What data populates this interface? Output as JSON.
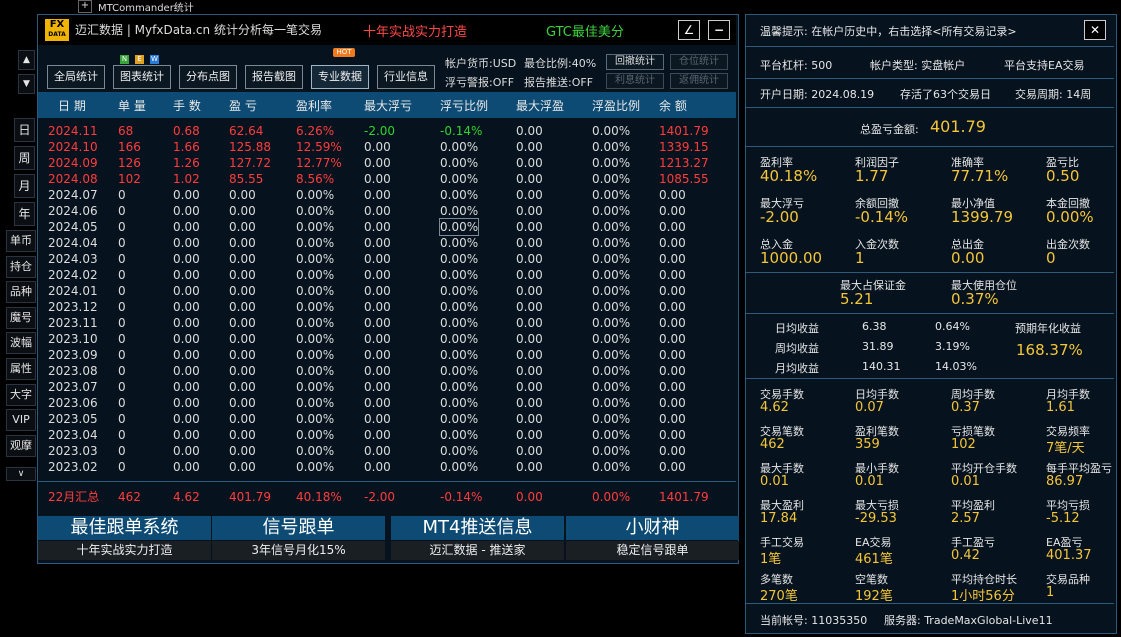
{
  "window": {
    "title": "MTCommander统计",
    "plus": "+"
  },
  "header": {
    "logo_top": "FX",
    "logo_bottom": "DATA",
    "brand": "迈汇数据 | MyfxData.cn  统计分析每一笔交易",
    "slogan1": "十年实战实力打造",
    "slogan2": "GTC最佳美分",
    "edit_btn": "∠",
    "min_btn": "−"
  },
  "sidebar": {
    "up": "▲",
    "down": "▼",
    "period": [
      "日",
      "周",
      "月",
      "年"
    ],
    "items": [
      "单币",
      "持仓",
      "品种",
      "魔号",
      "波幅",
      "属性",
      "大字",
      "VIP",
      "观摩"
    ],
    "more": "∨"
  },
  "toolbar": {
    "buttons": [
      "全局统计",
      "图表统计",
      "分布点图",
      "报告截图",
      "专业数据",
      "行业信息"
    ],
    "badges": {
      "n": "N",
      "e": "E",
      "w": "W",
      "hot": "HOT"
    },
    "account_currency": "帐户货币:USD",
    "max_position": "最仓比例:40%",
    "float_alert": "浮亏警报:OFF",
    "report_push": "报告推送:OFF",
    "small": [
      "回撤统计",
      "仓位统计",
      "利息统计",
      "返佣统计"
    ]
  },
  "table": {
    "headers": [
      "日 期",
      "单 量",
      "手 数",
      "盈 亏",
      "盈利率",
      "最大浮亏",
      "浮亏比例",
      "最大浮盈",
      "浮盈比例",
      "余 额"
    ],
    "rows": [
      [
        "2024.11",
        "68",
        "0.68",
        "62.64",
        "6.26%",
        "-2.00",
        "-0.14%",
        "0.00",
        "0.00%",
        "1401.79"
      ],
      [
        "2024.10",
        "166",
        "1.66",
        "125.88",
        "12.59%",
        "0.00",
        "0.00%",
        "0.00",
        "0.00%",
        "1339.15"
      ],
      [
        "2024.09",
        "126",
        "1.26",
        "127.72",
        "12.77%",
        "0.00",
        "0.00%",
        "0.00",
        "0.00%",
        "1213.27"
      ],
      [
        "2024.08",
        "102",
        "1.02",
        "85.55",
        "8.56%",
        "0.00",
        "0.00%",
        "0.00",
        "0.00%",
        "1085.55"
      ],
      [
        "2024.07",
        "0",
        "0.00",
        "0.00",
        "0.00%",
        "0.00",
        "0.00%",
        "0.00",
        "0.00%",
        "0.00"
      ],
      [
        "2024.06",
        "0",
        "0.00",
        "0.00",
        "0.00%",
        "0.00",
        "0.00%",
        "0.00",
        "0.00%",
        "0.00"
      ],
      [
        "2024.05",
        "0",
        "0.00",
        "0.00",
        "0.00%",
        "0.00",
        "0.00%",
        "0.00",
        "0.00%",
        "0.00"
      ],
      [
        "2024.04",
        "0",
        "0.00",
        "0.00",
        "0.00%",
        "0.00",
        "0.00%",
        "0.00",
        "0.00%",
        "0.00"
      ],
      [
        "2024.03",
        "0",
        "0.00",
        "0.00",
        "0.00%",
        "0.00",
        "0.00%",
        "0.00",
        "0.00%",
        "0.00"
      ],
      [
        "2024.02",
        "0",
        "0.00",
        "0.00",
        "0.00%",
        "0.00",
        "0.00%",
        "0.00",
        "0.00%",
        "0.00"
      ],
      [
        "2024.01",
        "0",
        "0.00",
        "0.00",
        "0.00%",
        "0.00",
        "0.00%",
        "0.00",
        "0.00%",
        "0.00"
      ],
      [
        "2023.12",
        "0",
        "0.00",
        "0.00",
        "0.00%",
        "0.00",
        "0.00%",
        "0.00",
        "0.00%",
        "0.00"
      ],
      [
        "2023.11",
        "0",
        "0.00",
        "0.00",
        "0.00%",
        "0.00",
        "0.00%",
        "0.00",
        "0.00%",
        "0.00"
      ],
      [
        "2023.10",
        "0",
        "0.00",
        "0.00",
        "0.00%",
        "0.00",
        "0.00%",
        "0.00",
        "0.00%",
        "0.00"
      ],
      [
        "2023.09",
        "0",
        "0.00",
        "0.00",
        "0.00%",
        "0.00",
        "0.00%",
        "0.00",
        "0.00%",
        "0.00"
      ],
      [
        "2023.08",
        "0",
        "0.00",
        "0.00",
        "0.00%",
        "0.00",
        "0.00%",
        "0.00",
        "0.00%",
        "0.00"
      ],
      [
        "2023.07",
        "0",
        "0.00",
        "0.00",
        "0.00%",
        "0.00",
        "0.00%",
        "0.00",
        "0.00%",
        "0.00"
      ],
      [
        "2023.06",
        "0",
        "0.00",
        "0.00",
        "0.00%",
        "0.00",
        "0.00%",
        "0.00",
        "0.00%",
        "0.00"
      ],
      [
        "2023.05",
        "0",
        "0.00",
        "0.00",
        "0.00%",
        "0.00",
        "0.00%",
        "0.00",
        "0.00%",
        "0.00"
      ],
      [
        "2023.04",
        "0",
        "0.00",
        "0.00",
        "0.00%",
        "0.00",
        "0.00%",
        "0.00",
        "0.00%",
        "0.00"
      ],
      [
        "2023.03",
        "0",
        "0.00",
        "0.00",
        "0.00%",
        "0.00",
        "0.00%",
        "0.00",
        "0.00%",
        "0.00"
      ],
      [
        "2023.02",
        "0",
        "0.00",
        "0.00",
        "0.00%",
        "0.00",
        "0.00%",
        "0.00",
        "0.00%",
        "0.00"
      ]
    ],
    "summary": [
      "22月汇总",
      "462",
      "4.62",
      "401.79",
      "40.18%",
      "-2.00",
      "-0.14%",
      "0.00",
      "0.00%",
      "1401.79"
    ]
  },
  "promos": [
    {
      "title": "最佳跟单系统",
      "sub": "十年实战实力打造"
    },
    {
      "title": "信号跟单",
      "sub": "3年信号月化15%"
    },
    {
      "title": "MT4推送信息",
      "sub": "迈汇数据 - 推送家"
    },
    {
      "title": "小财神",
      "sub": "稳定信号跟单"
    }
  ],
  "right": {
    "tip": "温馨提示: 在帐户历史中，右击选择<所有交易记录>",
    "close": "✕",
    "leverage": "平台杠杆: 500",
    "account_type": "帐户类型: 实盘帐户",
    "ea_support": "平台支持EA交易",
    "open_date": "开户日期: 2024.08.19",
    "stored_days": "存活了63个交易日",
    "trade_period": "交易周期: 14周",
    "total_pl_label": "总盈亏金额:",
    "total_pl": "401.79",
    "stats1": [
      {
        "label": "盈利率",
        "value": "40.18%"
      },
      {
        "label": "利润因子",
        "value": "1.77"
      },
      {
        "label": "准确率",
        "value": "77.71%"
      },
      {
        "label": "盈亏比",
        "value": "0.50"
      },
      {
        "label": "最大浮亏",
        "value": "-2.00"
      },
      {
        "label": "余额回撤",
        "value": "-0.14%"
      },
      {
        "label": "最小净值",
        "value": "1399.79"
      },
      {
        "label": "本金回撤",
        "value": "0.00%"
      },
      {
        "label": "总入金",
        "value": "1000.00"
      },
      {
        "label": "入金次数",
        "value": "1"
      },
      {
        "label": "总出金",
        "value": "0.00"
      },
      {
        "label": "出金次数",
        "value": "0"
      }
    ],
    "margin": [
      {
        "label": "最大占保证金",
        "value": "5.21"
      },
      {
        "label": "最大使用仓位",
        "value": "0.37%"
      }
    ],
    "avg": [
      {
        "label": "日均收益",
        "v1": "6.38",
        "v2": "0.64%"
      },
      {
        "label": "周均收益",
        "v1": "31.89",
        "v2": "3.19%"
      },
      {
        "label": "月均收益",
        "v1": "140.31",
        "v2": "14.03%"
      }
    ],
    "annual_label": "预期年化收益",
    "annual": "168.37%",
    "stats2": [
      {
        "label": "交易手数",
        "value": "4.62"
      },
      {
        "label": "日均手数",
        "value": "0.07"
      },
      {
        "label": "周均手数",
        "value": "0.37"
      },
      {
        "label": "月均手数",
        "value": "1.61"
      },
      {
        "label": "交易笔数",
        "value": "462"
      },
      {
        "label": "盈利笔数",
        "value": "359"
      },
      {
        "label": "亏损笔数",
        "value": "102"
      },
      {
        "label": "交易频率",
        "value": "7笔/天"
      },
      {
        "label": "最大手数",
        "value": "0.01"
      },
      {
        "label": "最小手数",
        "value": "0.01"
      },
      {
        "label": "平均开仓手数",
        "value": "0.01"
      },
      {
        "label": "每手平均盈亏",
        "value": "86.97"
      },
      {
        "label": "最大盈利",
        "value": "17.84"
      },
      {
        "label": "最大亏损",
        "value": "-29.53"
      },
      {
        "label": "平均盈利",
        "value": "2.57"
      },
      {
        "label": "平均亏损",
        "value": "-5.12"
      },
      {
        "label": "手工交易",
        "value": "1笔"
      },
      {
        "label": "EA交易",
        "value": "461笔"
      },
      {
        "label": "手工盈亏",
        "value": "0.42"
      },
      {
        "label": "EA盈亏",
        "value": "401.37"
      },
      {
        "label": "多笔数",
        "value": "270笔"
      },
      {
        "label": "空笔数",
        "value": "192笔"
      },
      {
        "label": "平均持仓时长",
        "value": "1小时56分"
      },
      {
        "label": "交易品种",
        "value": "1"
      }
    ],
    "account_no": "当前帐号: 11035350",
    "server": "服务器: TradeMaxGlobal-Live11"
  },
  "colors": {
    "red": "#ff3d3d",
    "green": "#2fd42f",
    "gold": "#f3c63a",
    "blue": "#0d4b74"
  }
}
